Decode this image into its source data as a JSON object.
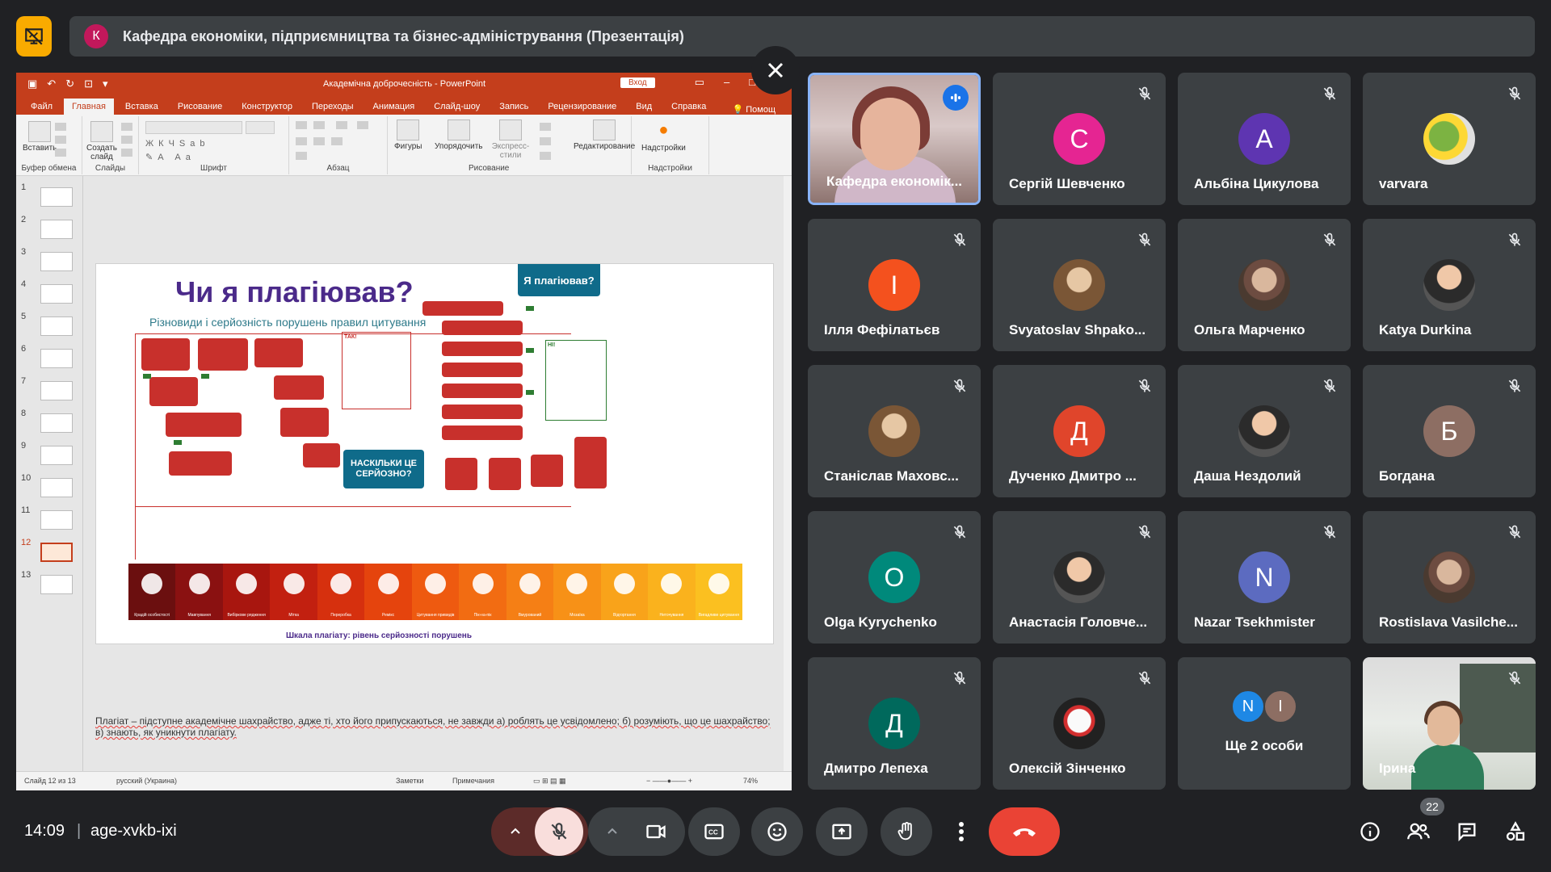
{
  "meeting": {
    "presentation_title": "Кафедра економіки, підприємництва та бізнес-адміністрування (Презентація)",
    "presenter_avatar_letter": "К",
    "time": "14:09",
    "meeting_code": "age-xvkb-ixi",
    "participant_count": "22"
  },
  "powerpoint": {
    "doc_title": "Академічна доброчесність - PowerPoint",
    "login_label": "Вход",
    "tabs": [
      "Файл",
      "Главная",
      "Вставка",
      "Рисование",
      "Конструктор",
      "Переходы",
      "Анимация",
      "Слайд-шоу",
      "Запись",
      "Рецензирование",
      "Вид",
      "Справка"
    ],
    "help_label": "Помощ",
    "ribbon": {
      "paste": "Вставить",
      "clipboard": "Буфер обмена",
      "new_slide": "Создать слайд",
      "slides": "Слайды",
      "font": "Шрифт",
      "paragraph": "Абзац",
      "shapes": "Фигуры",
      "arrange": "Упорядочить",
      "express_styles": "Экспресс-стили",
      "drawing": "Рисование",
      "editing": "Редактирование",
      "addins": "Надстройки",
      "addins_group": "Надстройки"
    },
    "thumbnail_numbers": [
      "1",
      "2",
      "3",
      "4",
      "5",
      "6",
      "7",
      "8",
      "9",
      "10",
      "11",
      "12",
      "13"
    ],
    "active_slide_index": 12,
    "slide": {
      "title": "Чи я плагіював?",
      "subtitle": "Різновиди і серйозність порушень правил цитування",
      "tag": "Я плагіював?",
      "callout": "НАСКІЛЬКИ ЦЕ СЕРЙОЗНО?",
      "scale_caption": "Шкала плагіату: рівень серйозності порушень",
      "scale_labels": [
        "Крадій особистості",
        "Мавпування",
        "Вибіркове рядження",
        "Мітка",
        "Переробка",
        "Ремікс",
        "Цитування привидів",
        "Пік-на-пік",
        "Вмурований",
        "Мозаїка",
        "Відгортання",
        "Неточування",
        "Вигадливе цитування"
      ]
    },
    "notes_text": "Плагіат – підступне академічне шахрайство, адже ті, хто його припускаються, не завжди а) роблять це усвідомлено; б) розуміють, що це шахрайство; в) знають, як уникнути плагіату.",
    "status": {
      "slide_counter": "Слайд 12 из 13",
      "language": "русский (Украина)",
      "notes": "Заметки",
      "comments": "Примечания",
      "zoom": "74%"
    }
  },
  "participants": [
    {
      "name": "Кафедра економік...",
      "type": "camera1",
      "speaking": true
    },
    {
      "name": "Сергій Шевченко",
      "letter": "С",
      "color": "#e52592"
    },
    {
      "name": "Альбіна Цикулова",
      "letter": "А",
      "color": "#5e35b1"
    },
    {
      "name": "varvara",
      "type": "photo-bird"
    },
    {
      "name": "Ілля Фефілатьєв",
      "letter": "І",
      "color": "#f4511e"
    },
    {
      "name": "Svyatoslav Shpako...",
      "type": "photo"
    },
    {
      "name": "Ольга Марченко",
      "type": "photo"
    },
    {
      "name": "Katya Durkina",
      "type": "photo"
    },
    {
      "name": "Станіслав Маховс...",
      "type": "photo"
    },
    {
      "name": "Дученко Дмитро ...",
      "letter": "Д",
      "color": "#e0452b"
    },
    {
      "name": "Даша Нездолий",
      "type": "photo"
    },
    {
      "name": "Богдана",
      "letter": "Б",
      "color": "#8d6e63"
    },
    {
      "name": "Olga Kyrychenko",
      "letter": "О",
      "color": "#00897b"
    },
    {
      "name": "Анастасія Головче...",
      "type": "photo"
    },
    {
      "name": "Nazar Tsekhmister",
      "letter": "N",
      "color": "#5c6bc0"
    },
    {
      "name": "Rostislava Vasilche...",
      "type": "photo"
    },
    {
      "name": "Дмитро Лепеха",
      "letter": "Д",
      "color": "#00695c"
    },
    {
      "name": "Олексій Зінченко",
      "type": "photo-mask"
    },
    {
      "name": "Ще 2 особи",
      "type": "more",
      "letters": [
        "N",
        "І"
      ],
      "colors": [
        "#1e88e5",
        "#8d6e63"
      ]
    },
    {
      "name": "Ірина",
      "type": "camera2"
    }
  ],
  "colors": {
    "background": "#202124",
    "tile": "#3c4043",
    "end_call": "#ea4335",
    "mic_off_bg": "#f9dedc",
    "powerpoint_accent": "#c43e1c",
    "speaking_border": "#8ab4f8"
  },
  "icons": {
    "logo": "presentation-off-icon",
    "close": "close-icon",
    "mute": "mic-off-icon",
    "speaking": "audio-level-icon"
  }
}
